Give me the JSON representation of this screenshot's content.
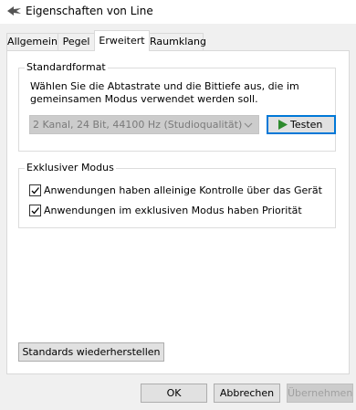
{
  "window": {
    "title": "Eigenschaften von Line",
    "icon": "speaker-icon"
  },
  "tabs": [
    {
      "label": "Allgemein",
      "active": false
    },
    {
      "label": "Pegel",
      "active": false
    },
    {
      "label": "Erweitert",
      "active": true
    },
    {
      "label": "Raumklang",
      "active": false
    }
  ],
  "standardformat": {
    "label": "Standardformat",
    "description": "Wählen Sie die Abtastrate und die Bittiefe aus, die im gemeinsamen Modus verwendet werden soll.",
    "selected_format": "2 Kanal, 24 Bit, 44100 Hz (Studioqualität)",
    "test_button": "Testen"
  },
  "exclusive": {
    "label": "Exklusiver Modus",
    "options": [
      {
        "label": "Anwendungen haben alleinige Kontrolle über das Gerät",
        "checked": true
      },
      {
        "label": "Anwendungen im exklusiven Modus haben Priorität",
        "checked": true
      }
    ]
  },
  "restore_button": "Standards wiederherstellen",
  "footer": {
    "ok": "OK",
    "cancel": "Abbrechen",
    "apply": "Übernehmen"
  },
  "colors": {
    "focus_border": "#0078d7",
    "play_icon": "#2e8b2e"
  }
}
